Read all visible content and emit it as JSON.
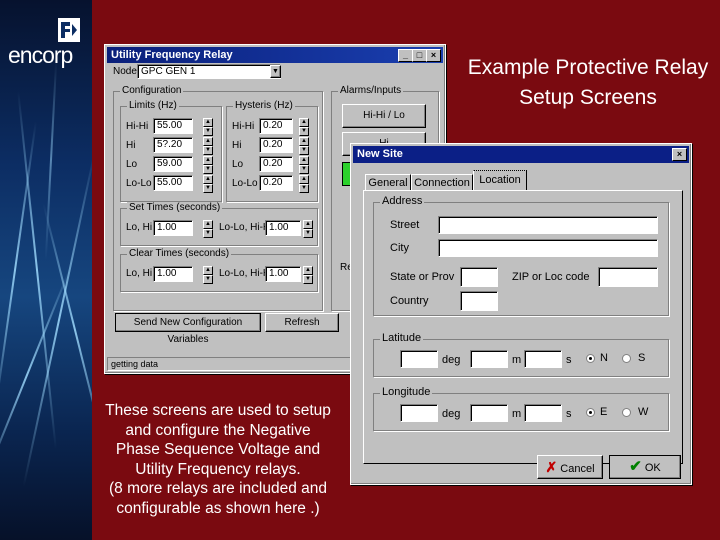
{
  "slide": {
    "logo_text": "encorp",
    "title": "Example Protective Relay Setup Screens",
    "caption_lines": [
      "These screens are used to setup",
      "and configure the Negative",
      "Phase Sequence Voltage and",
      "Utility Frequency relays.",
      "(8 more relays are included and",
      "configurable  as shown here .)"
    ]
  },
  "relay_window": {
    "title": "Utility Frequency Relay",
    "node_label": "Node",
    "node_value": "GPC GEN 1",
    "configuration_group": "Configuration",
    "limits_group": "Limits (Hz)",
    "hysteresis_group": "Hysteris (Hz)",
    "limit_rows": [
      {
        "label": "Hi-Hi",
        "value": "55.00"
      },
      {
        "label": "Hi",
        "value": "5?.20"
      },
      {
        "label": "Lo",
        "value": "59.00"
      },
      {
        "label": "Lo-Lo",
        "value": "55.00"
      }
    ],
    "hyst_rows": [
      {
        "label": "Hi-Hi",
        "value": "0.20"
      },
      {
        "label": "Hi",
        "value": "0.20"
      },
      {
        "label": "Lo",
        "value": "0.20"
      },
      {
        "label": "Lo-Lo",
        "value": "0.20"
      }
    ],
    "set_times_group": "Set Times (seconds)",
    "clear_times_group": "Clear Times (seconds)",
    "set_lo_label": "Lo, Hi",
    "set_lo_value": "1.00",
    "set_lolo_label": "Lo-Lo, Hi-Hi",
    "set_lolo_value": "1.00",
    "clear_lo_label": "Lo, Hi",
    "clear_lo_value": "1.00",
    "clear_lolo_label": "Lo-Lo, Hi-Hi",
    "clear_lolo_value": "1.00",
    "alarms_group": "Alarms/Inputs",
    "alarm_button": "Hi-Hi / Lo",
    "alarm_button2": "Hi",
    "side_label": "Re",
    "send_button": "Send New Configuration Variables",
    "refresh_button": "Refresh",
    "status_text": "getting data"
  },
  "newsite_window": {
    "title": "New Site",
    "tabs": [
      "General",
      "Connection",
      "Location"
    ],
    "address_group": "Address",
    "street_label": "Street",
    "city_label": "City",
    "state_label": "State or Prov",
    "zip_label": "ZIP or Loc code",
    "country_label": "Country",
    "latitude_group": "Latitude",
    "longitude_group": "Longitude",
    "deg_label": "deg",
    "m_label": "m",
    "s_label": "s",
    "lat_dir": [
      "N",
      "S"
    ],
    "lon_dir": [
      "E",
      "W"
    ],
    "cancel_button": "Cancel",
    "ok_button": "OK"
  },
  "colors": {
    "background": "#7a0a10",
    "title_bar": "#0b1f86",
    "window": "#c0c0c0"
  }
}
